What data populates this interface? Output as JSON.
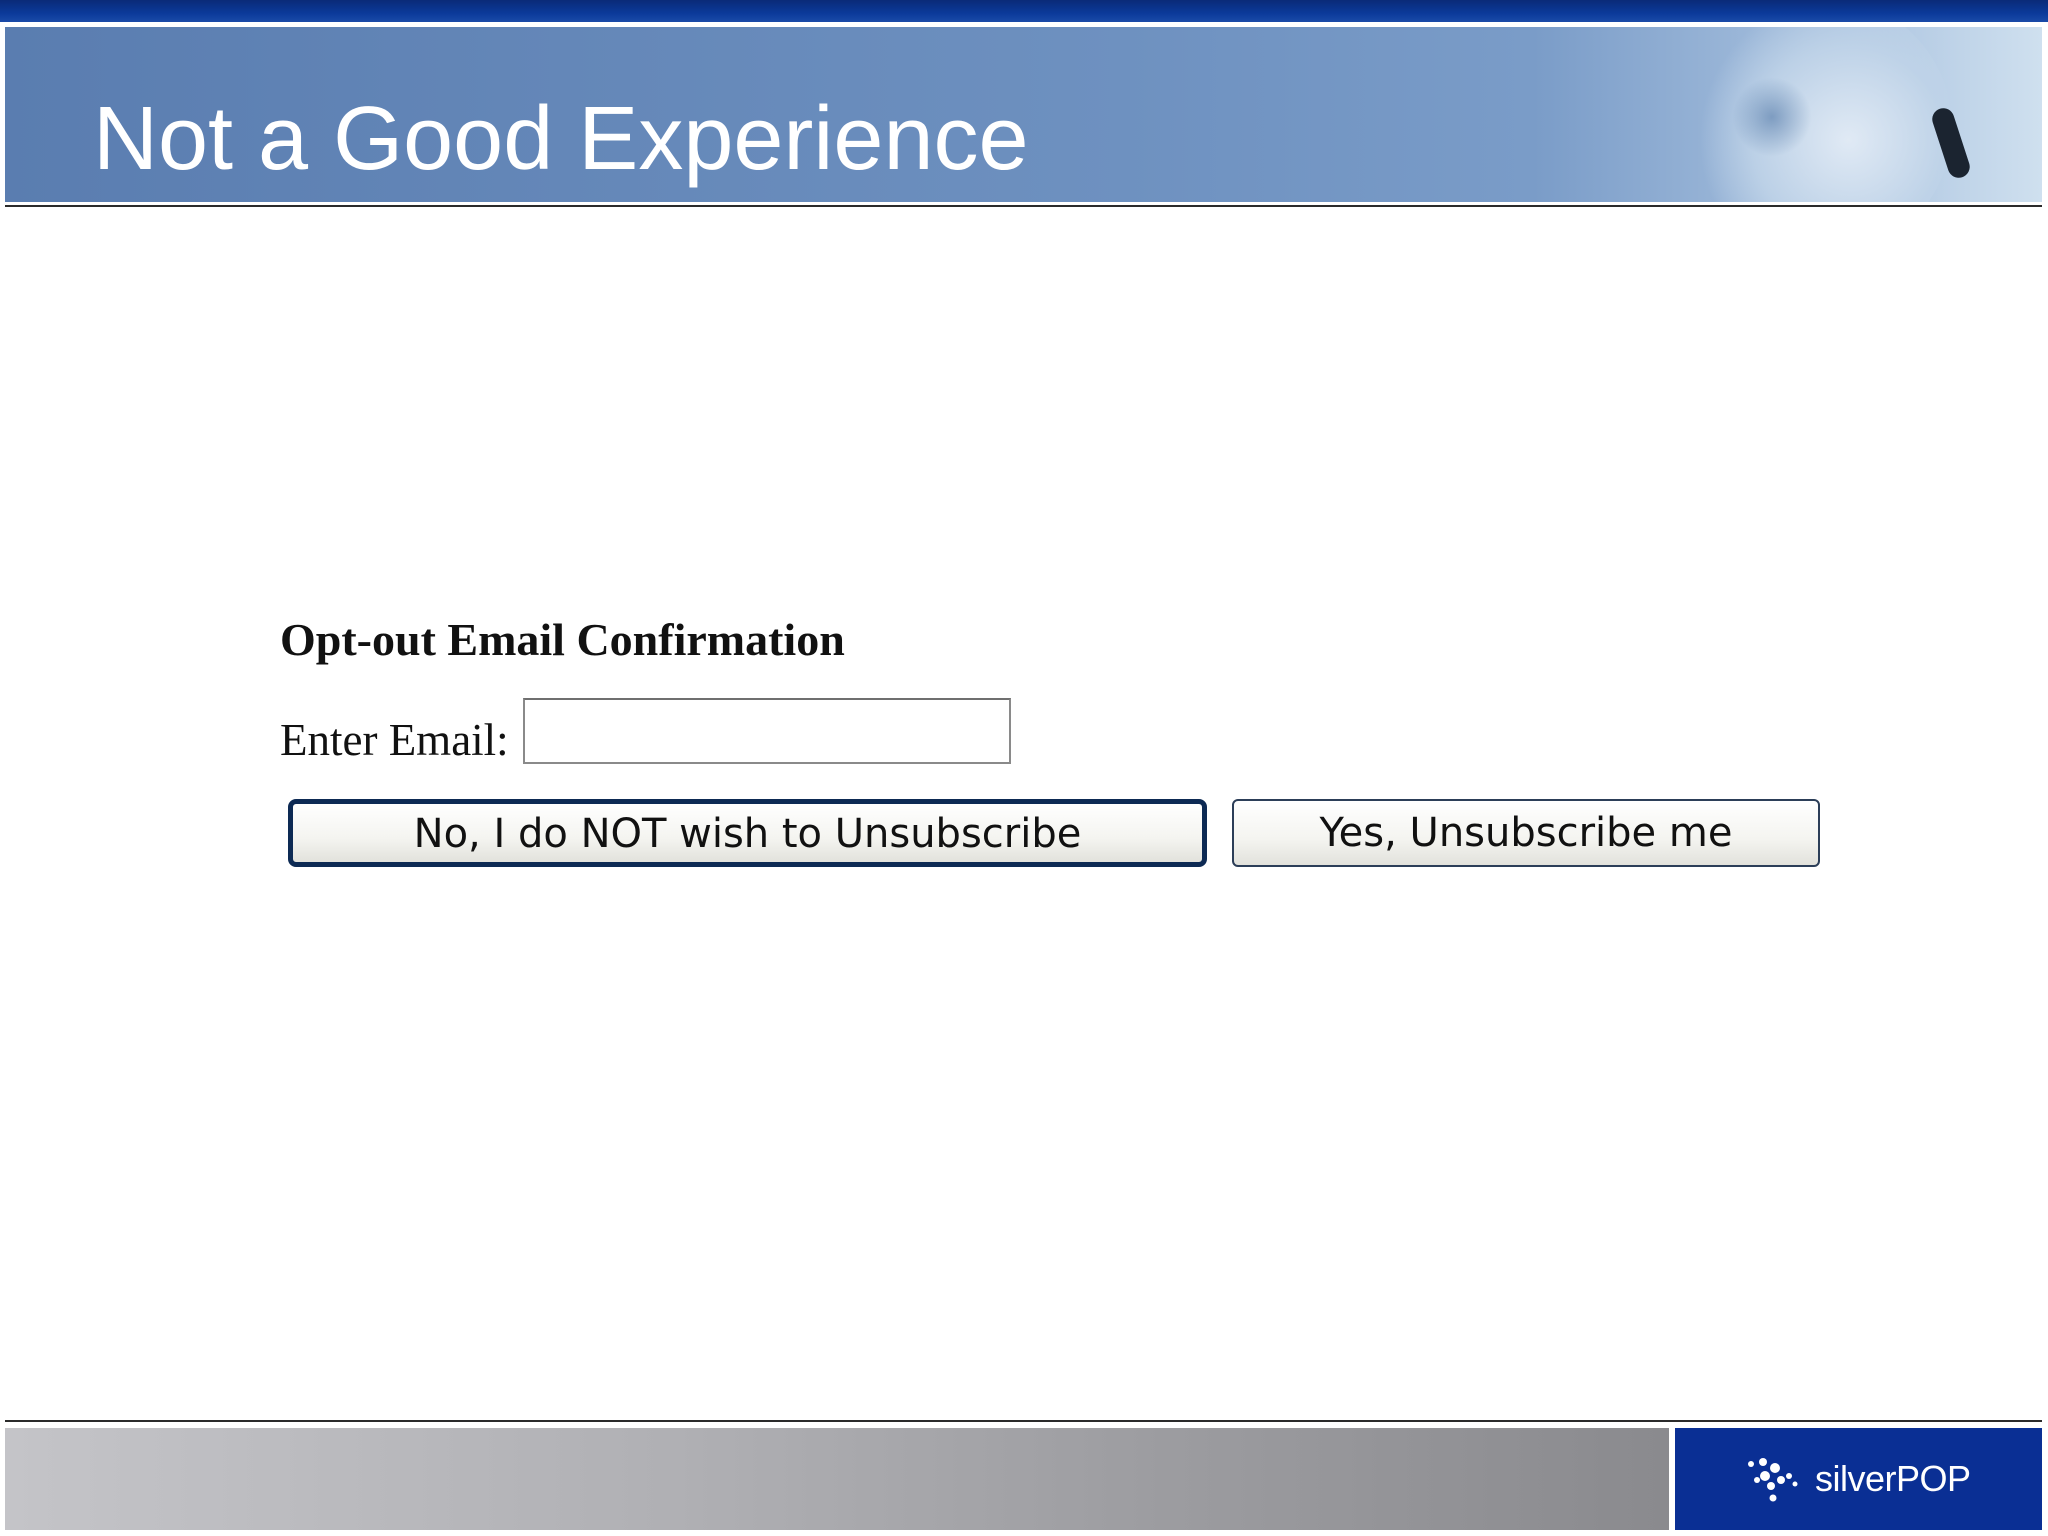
{
  "header": {
    "title": "Not a Good Experience"
  },
  "form": {
    "heading": "Opt-out Email Confirmation",
    "email_label": "Enter Email:",
    "email_value": "",
    "no_button_label": "No, I do NOT wish to Unsubscribe",
    "yes_button_label": "Yes, Unsubscribe me"
  },
  "footer": {
    "logo_text": "silverPOP"
  },
  "colors": {
    "top_bar": "#0a2a78",
    "header_band": "#6e91c0",
    "logo_background": "#0a2f94",
    "focused_button_border": "#0d2a54"
  },
  "icons": {
    "logo": "silverpop-logo-icon"
  }
}
